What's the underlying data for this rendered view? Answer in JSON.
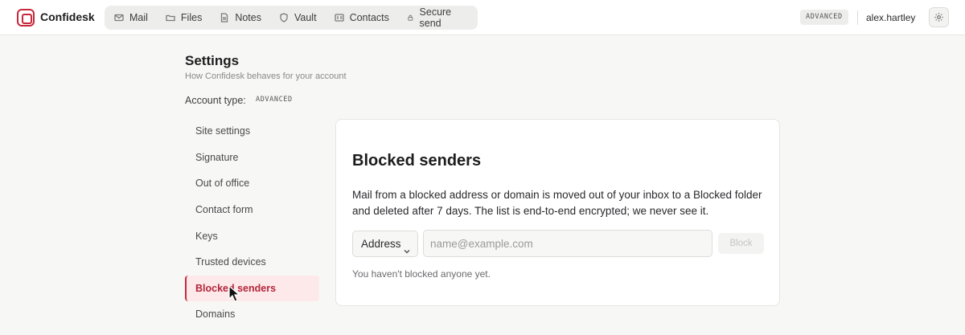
{
  "app": {
    "name": "Confidesk"
  },
  "nav": [
    {
      "label": "Mail",
      "icon": "mail-icon"
    },
    {
      "label": "Files",
      "icon": "folder-icon"
    },
    {
      "label": "Notes",
      "icon": "note-icon"
    },
    {
      "label": "Vault",
      "icon": "shield-icon"
    },
    {
      "label": "Contacts",
      "icon": "contact-card-icon"
    },
    {
      "label": "Secure send",
      "icon": "lock-icon"
    }
  ],
  "header": {
    "plan_badge": "ADVANCED",
    "username": "alex.hartley"
  },
  "settings": {
    "title": "Settings",
    "subtitle": "How Confidesk behaves for your account",
    "account_type_label": "Account type:",
    "account_type_value": "ADVANCED"
  },
  "sidebar": {
    "items": [
      {
        "label": "Site settings"
      },
      {
        "label": "Signature"
      },
      {
        "label": "Out of office"
      },
      {
        "label": "Contact form"
      },
      {
        "label": "Keys"
      },
      {
        "label": "Trusted devices"
      },
      {
        "label": "Blocked senders",
        "active": true
      },
      {
        "label": "Domains"
      }
    ]
  },
  "panel": {
    "title": "Blocked senders",
    "description": "Mail from a blocked address or domain is moved out of your inbox to a Blocked folder and deleted after 7 days. The list is end-to-end encrypted; we never see it.",
    "type_select_value": "Address",
    "input_placeholder": "name@example.com",
    "input_value": "",
    "block_button_label": "Block",
    "empty_message": "You haven't blocked anyone yet."
  },
  "colors": {
    "accent": "#c8283c",
    "active_bg": "#fde9ea"
  }
}
